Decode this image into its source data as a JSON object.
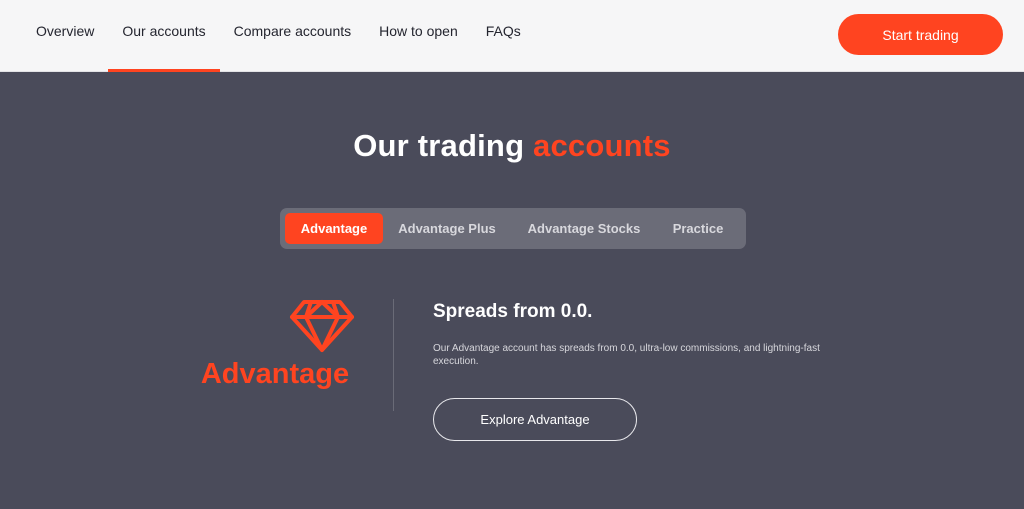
{
  "nav": {
    "items": [
      {
        "label": "Overview",
        "active": false
      },
      {
        "label": "Our accounts",
        "active": true
      },
      {
        "label": "Compare accounts",
        "active": false
      },
      {
        "label": "How to open",
        "active": false
      },
      {
        "label": "FAQs",
        "active": false
      }
    ],
    "cta_label": "Start trading"
  },
  "hero": {
    "title_main": "Our trading",
    "title_accent": "accounts"
  },
  "tabs": [
    {
      "label": "Advantage",
      "active": true
    },
    {
      "label": "Advantage Plus",
      "active": false
    },
    {
      "label": "Advantage Stocks",
      "active": false
    },
    {
      "label": "Practice",
      "active": false
    }
  ],
  "account": {
    "icon": "diamond-icon",
    "name": "Advantage",
    "headline": "Spreads from 0.0.",
    "description": "Our Advantage account has spreads from 0.0, ultra-low commissions, and lightning-fast execution.",
    "button_label": "Explore Advantage"
  },
  "colors": {
    "accent": "#ff4420",
    "background": "#4a4b5a",
    "topbar": "#f6f6f7",
    "tab_track": "#6b6c78"
  }
}
